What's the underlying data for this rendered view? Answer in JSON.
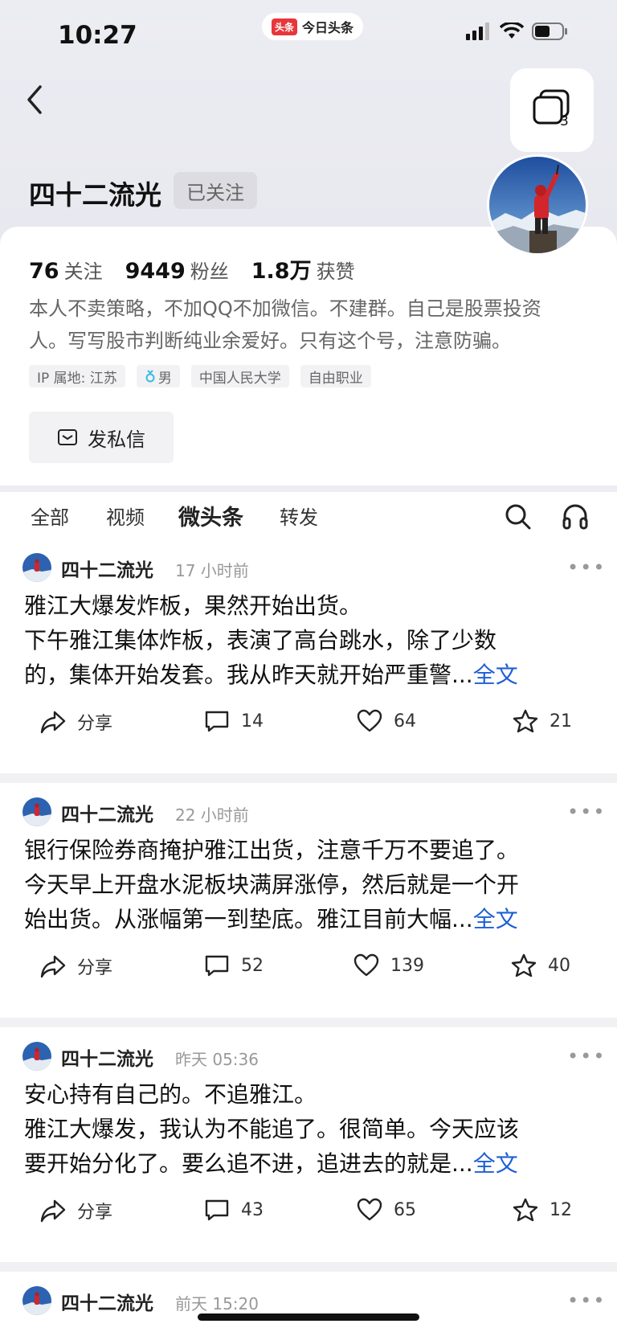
{
  "status_bar": {
    "time": "10:27",
    "app_logo": "头条",
    "app_name": "今日头条"
  },
  "header": {
    "window_count": "3"
  },
  "profile": {
    "name": "四十二流光",
    "follow_status": "已关注",
    "stats": [
      {
        "num": "76",
        "label": "关注"
      },
      {
        "num": "9449",
        "label": "粉丝"
      },
      {
        "num": "1.8万",
        "label": "获赞"
      }
    ],
    "bio_line1": "本人不卖策略，不加QQ不加微信。不建群。自己是股票投资",
    "bio_line2": "人。写写股市判断纯业余爱好。只有这个号，注意防骗。",
    "tags": [
      "IP 属地: 江苏",
      "男",
      "中国人民大学",
      "自由职业"
    ],
    "message_button": "发私信"
  },
  "tabs": [
    "全部",
    "视频",
    "微头条",
    "转发"
  ],
  "active_tab": "微头条",
  "posts": [
    {
      "author": "四十二流光",
      "time": "17 小时前",
      "line1": "雅江大爆发炸板，果然开始出货。",
      "line2": "下午雅江集体炸板，表演了高台跳水，除了少数",
      "line3": "的，集体开始发套。我从昨天就开始严重警...",
      "more_link": "全文",
      "share": "分享",
      "comments": "14",
      "likes": "64",
      "favorites": "21"
    },
    {
      "author": "四十二流光",
      "time": "22 小时前",
      "line1": "银行保险券商掩护雅江出货，注意千万不要追了。",
      "line2": "今天早上开盘水泥板块满屏涨停，然后就是一个开",
      "line3": "始出货。从涨幅第一到垫底。雅江目前大幅...",
      "more_link": "全文",
      "share": "分享",
      "comments": "52",
      "likes": "139",
      "favorites": "40"
    },
    {
      "author": "四十二流光",
      "time": "昨天 05:36",
      "line1": "安心持有自己的。不追雅江。",
      "line2": "雅江大爆发，我认为不能追了。很简单。今天应该",
      "line3": "要开始分化了。要么追不进，追进去的就是...",
      "more_link": "全文",
      "share": "分享",
      "comments": "43",
      "likes": "65",
      "favorites": "12"
    },
    {
      "author": "四十二流光",
      "time": "前天 15:20"
    }
  ]
}
